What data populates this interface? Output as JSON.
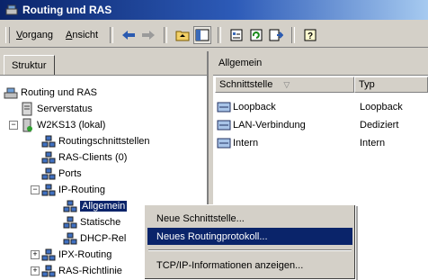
{
  "window": {
    "title": "Routing und RAS"
  },
  "menubar": {
    "items": [
      {
        "label": "Vorgang"
      },
      {
        "label": "Ansicht"
      }
    ]
  },
  "toolbar": {
    "icons": [
      "back-arrow-icon",
      "forward-arrow-icon",
      "up-folder-icon",
      "show-hide-tree-icon",
      "properties-icon",
      "refresh-icon",
      "export-list-icon",
      "help-icon"
    ]
  },
  "left_pane": {
    "tab_label": "Struktur",
    "tree": [
      {
        "label": "Routing und RAS"
      },
      {
        "label": "Serverstatus"
      },
      {
        "label": "W2KS13 (lokal)"
      },
      {
        "label": "Routingschnittstellen"
      },
      {
        "label": "RAS-Clients (0)"
      },
      {
        "label": "Ports"
      },
      {
        "label": "IP-Routing"
      },
      {
        "label": "Allgemein"
      },
      {
        "label": "Statische"
      },
      {
        "label": "DHCP-Rel"
      },
      {
        "label": "IPX-Routing"
      },
      {
        "label": "RAS-Richtlinie"
      }
    ]
  },
  "right_pane": {
    "header": "Allgemein",
    "columns": [
      {
        "label": "Schnittstelle"
      },
      {
        "label": "Typ"
      }
    ],
    "rows": [
      {
        "name": "Loopback",
        "type": "Loopback"
      },
      {
        "name": "LAN-Verbindung",
        "type": "Dediziert"
      },
      {
        "name": "Intern",
        "type": "Intern"
      }
    ]
  },
  "context_menu": {
    "items": [
      {
        "label": "Neue Schnittstelle..."
      },
      {
        "label": "Neues Routingprotokoll..."
      },
      {
        "label": "TCP/IP-Informationen anzeigen..."
      }
    ]
  },
  "colors": {
    "title_gradient_start": "#0a246a",
    "title_gradient_end": "#a6caf0",
    "selection": "#0a246a",
    "face": "#d4d0c8"
  }
}
